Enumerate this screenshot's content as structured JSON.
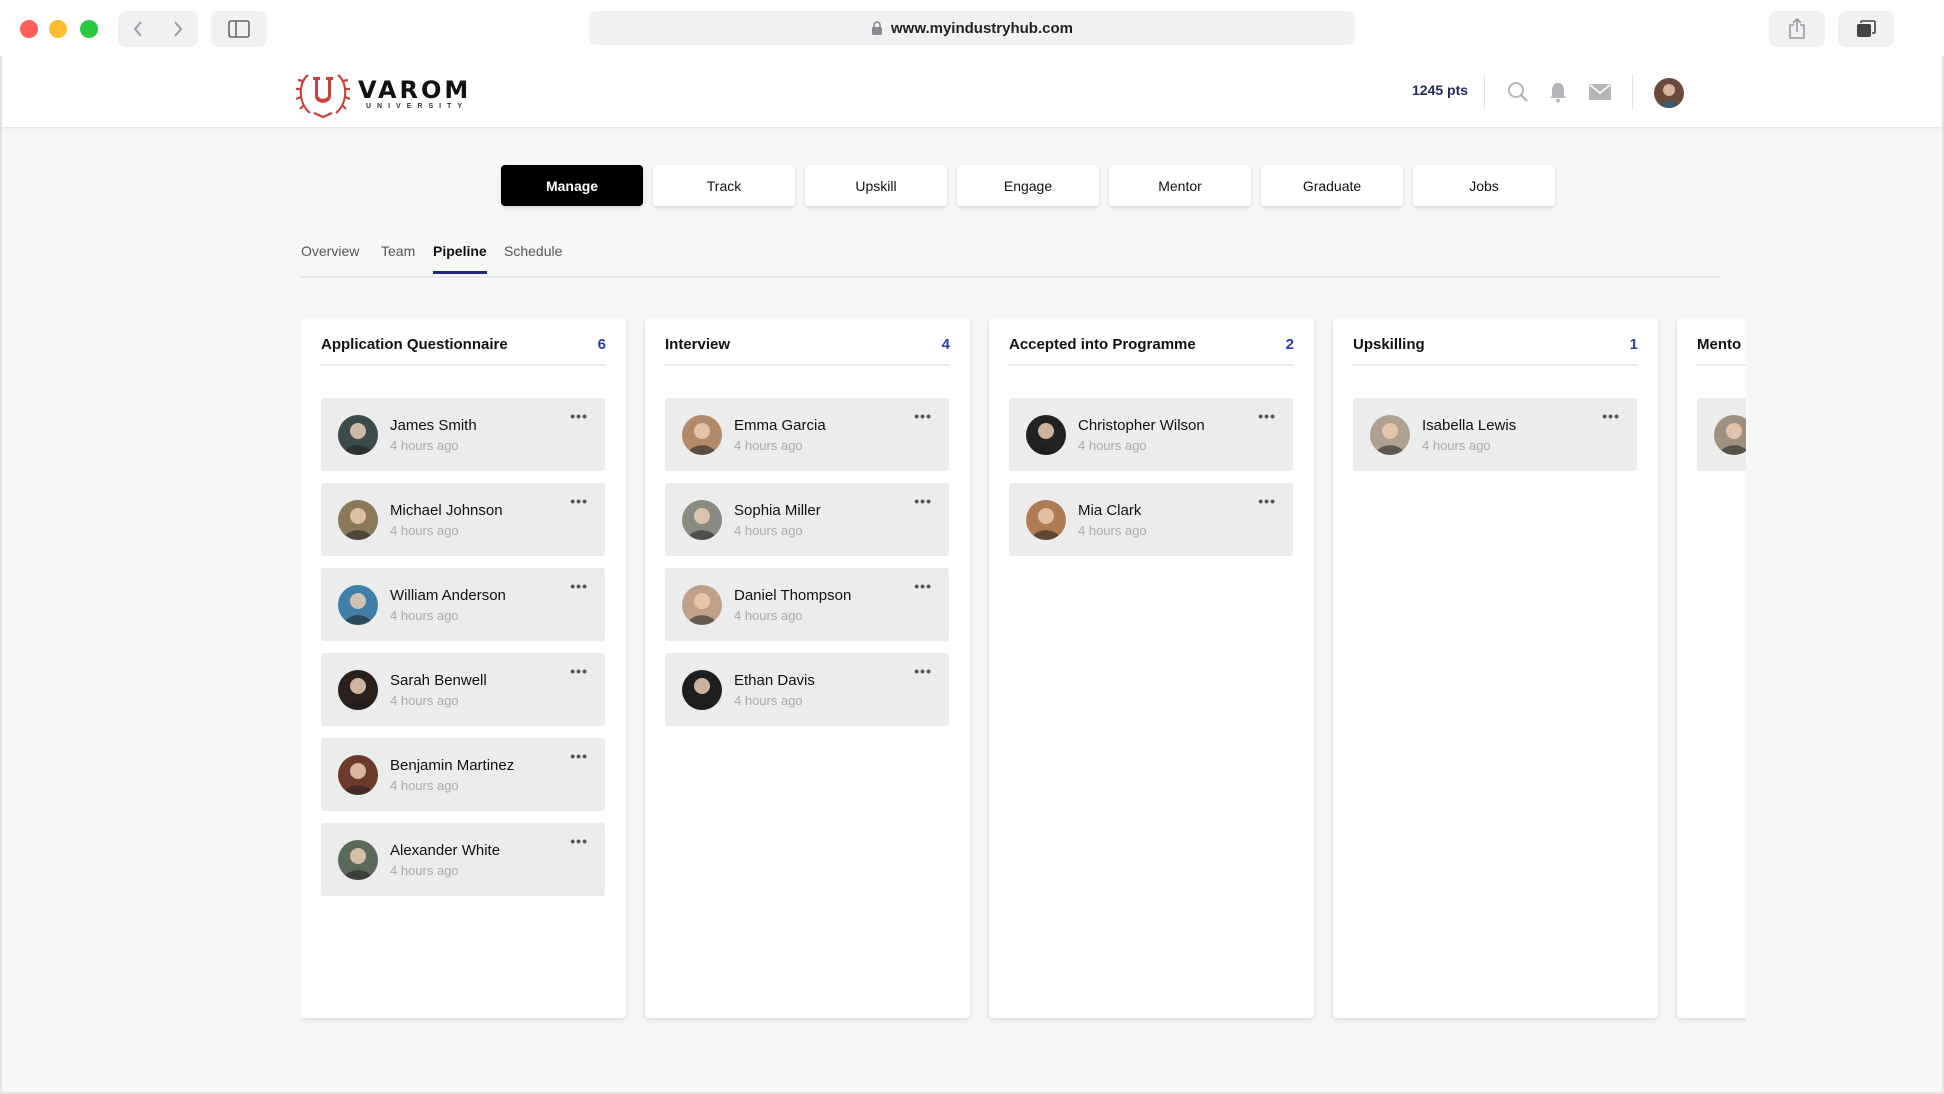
{
  "browser": {
    "url": "www.myindustryhub.com"
  },
  "header": {
    "logo_name": "VAROM",
    "logo_sub": "UNIVERSITY",
    "points": "1245 pts"
  },
  "main_tabs": [
    {
      "label": "Manage",
      "active": true
    },
    {
      "label": "Track"
    },
    {
      "label": "Upskill"
    },
    {
      "label": "Engage"
    },
    {
      "label": "Mentor"
    },
    {
      "label": "Graduate"
    },
    {
      "label": "Jobs"
    }
  ],
  "sub_tabs": [
    {
      "label": "Overview"
    },
    {
      "label": "Team"
    },
    {
      "label": "Pipeline",
      "active": true
    },
    {
      "label": "Schedule"
    }
  ],
  "columns": [
    {
      "title": "Application Questionnaire",
      "count": "6",
      "cards": [
        {
          "name": "James Smith",
          "time": "4 hours ago",
          "avatar_color": "#3b4a4a"
        },
        {
          "name": "Michael Johnson",
          "time": "4 hours ago",
          "avatar_color": "#8a7a5a"
        },
        {
          "name": "William Anderson",
          "time": "4 hours ago",
          "avatar_color": "#3f7fa8"
        },
        {
          "name": "Sarah Benwell",
          "time": "4 hours ago",
          "avatar_color": "#2a211d"
        },
        {
          "name": "Benjamin Martinez",
          "time": "4 hours ago",
          "avatar_color": "#6b3a2a"
        },
        {
          "name": "Alexander White",
          "time": "4 hours ago",
          "avatar_color": "#5a6a5a"
        }
      ]
    },
    {
      "title": "Interview",
      "count": "4",
      "cards": [
        {
          "name": "Emma Garcia",
          "time": "4 hours ago",
          "avatar_color": "#b08a6a"
        },
        {
          "name": "Sophia Miller",
          "time": "4 hours ago",
          "avatar_color": "#8a8a80"
        },
        {
          "name": "Daniel Thompson",
          "time": "4 hours ago",
          "avatar_color": "#c0a088"
        },
        {
          "name": "Ethan Davis",
          "time": "4 hours ago",
          "avatar_color": "#1e1e1e"
        }
      ]
    },
    {
      "title": "Accepted into Programme",
      "count": "2",
      "cards": [
        {
          "name": "Christopher Wilson",
          "time": "4 hours ago",
          "avatar_color": "#222222"
        },
        {
          "name": "Mia Clark",
          "time": "4 hours ago",
          "avatar_color": "#b07a55"
        }
      ]
    },
    {
      "title": "Upskilling",
      "count": "1",
      "cards": [
        {
          "name": "Isabella Lewis",
          "time": "4 hours ago",
          "avatar_color": "#b0a090"
        }
      ]
    },
    {
      "title": "Mento",
      "count": "",
      "cards": [
        {
          "name": "",
          "time": "",
          "avatar_color": "#a09080"
        }
      ]
    }
  ],
  "colors": {
    "accent": "#1f2a7a",
    "count_blue": "#2b3bb0",
    "active_tab_bg": "#000000",
    "page_bg": "#f7f7f8",
    "card_bg": "#ececec"
  }
}
